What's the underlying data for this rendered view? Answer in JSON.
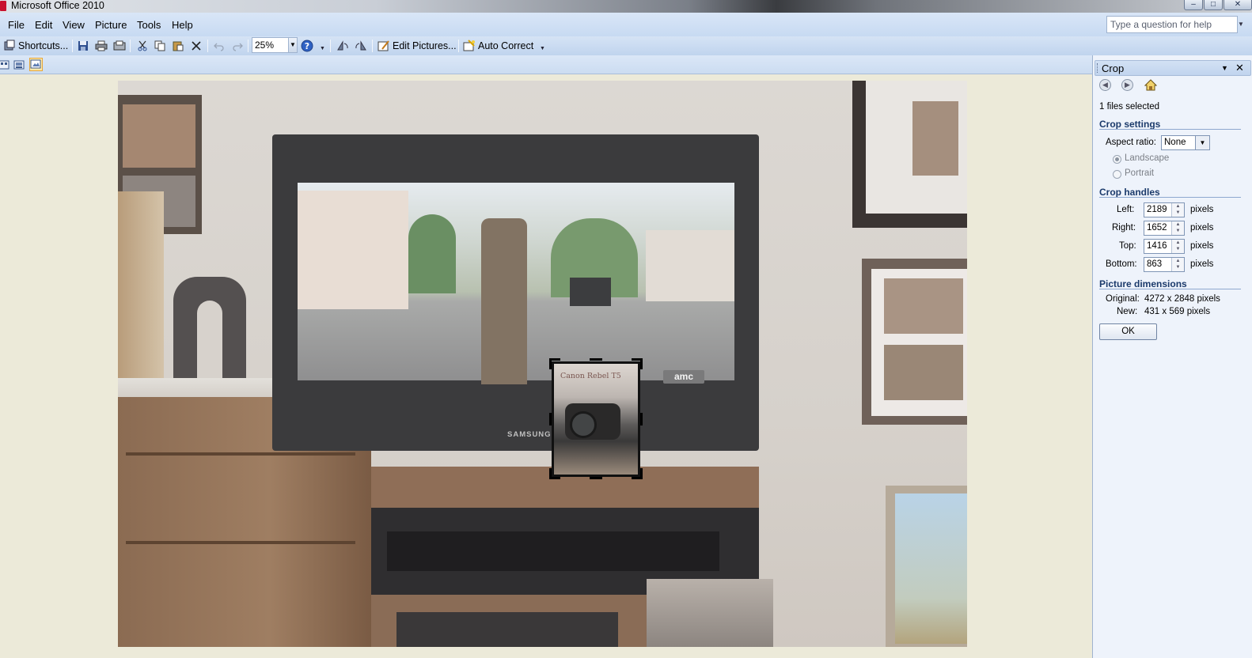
{
  "window": {
    "title": "Microsoft Office 2010",
    "buttons": [
      "–",
      "□",
      "✕"
    ]
  },
  "menu": {
    "items": [
      "File",
      "Edit",
      "View",
      "Picture",
      "Tools",
      "Help"
    ],
    "help_placeholder": "Type a question for help"
  },
  "toolbar": {
    "shortcuts_label": "Shortcuts...",
    "zoom_value": "25%",
    "edit_pictures_label": "Edit Pictures...",
    "auto_correct_label": "Auto Correct"
  },
  "pane": {
    "title": "Crop",
    "files_selected": "1 files selected",
    "crop_settings_heading": "Crop settings",
    "aspect_ratio_label": "Aspect ratio:",
    "aspect_ratio_value": "None",
    "landscape_label": "Landscape",
    "portrait_label": "Portrait",
    "crop_handles_heading": "Crop handles",
    "handles": [
      {
        "label": "Left:",
        "value": "2189",
        "unit": "pixels"
      },
      {
        "label": "Right:",
        "value": "1652",
        "unit": "pixels"
      },
      {
        "label": "Top:",
        "value": "1416",
        "unit": "pixels"
      },
      {
        "label": "Bottom:",
        "value": "863",
        "unit": "pixels"
      }
    ],
    "dimensions_heading": "Picture dimensions",
    "original_label": "Original:",
    "original_value": "4272 x 2848 pixels",
    "new_label": "New:",
    "new_value": "431 x 569 pixels",
    "ok_label": "OK"
  },
  "photo_text": {
    "tv_brand": "SAMSUNG",
    "channel_logo": "amc",
    "book_title": "Canon Rebel T5"
  }
}
